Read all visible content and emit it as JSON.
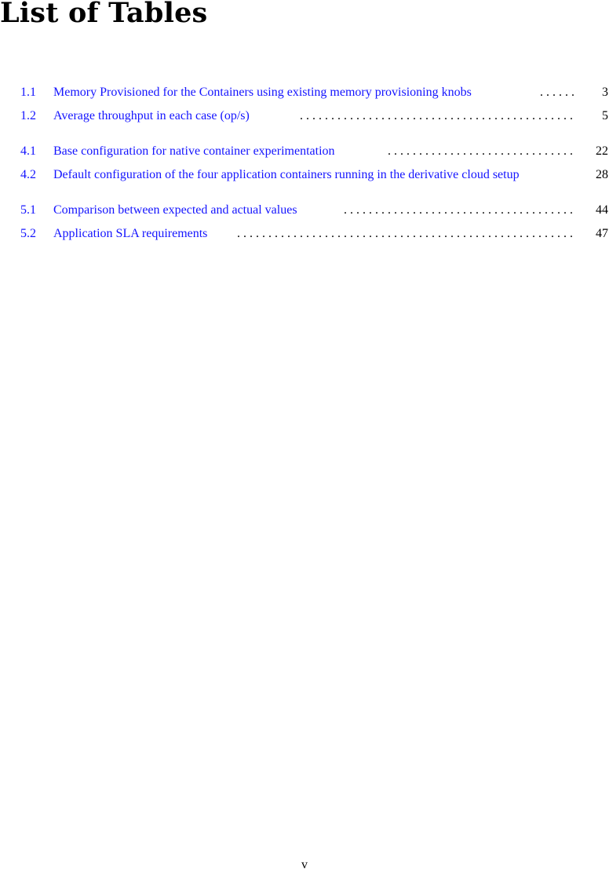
{
  "page": {
    "title": "List of Tables",
    "footer_page_number": "v"
  },
  "link_color": "#1414ff",
  "entries": [
    {
      "number": "1.1",
      "title": "Memory Provisioned for the Containers using existing memory provisioning knobs",
      "page": "3"
    },
    {
      "number": "1.2",
      "title": "Average throughput in each case (op/s)",
      "page": "5"
    },
    {
      "number": "4.1",
      "title": "Base configuration for native container experimentation",
      "page": "22"
    },
    {
      "number": "4.2",
      "title": "Default configuration of the four application containers running in the derivative cloud setup",
      "page": "28"
    },
    {
      "number": "5.1",
      "title": "Comparison between expected and actual values",
      "page": "44"
    },
    {
      "number": "5.2",
      "title": "Application SLA requirements",
      "page": "47"
    }
  ]
}
